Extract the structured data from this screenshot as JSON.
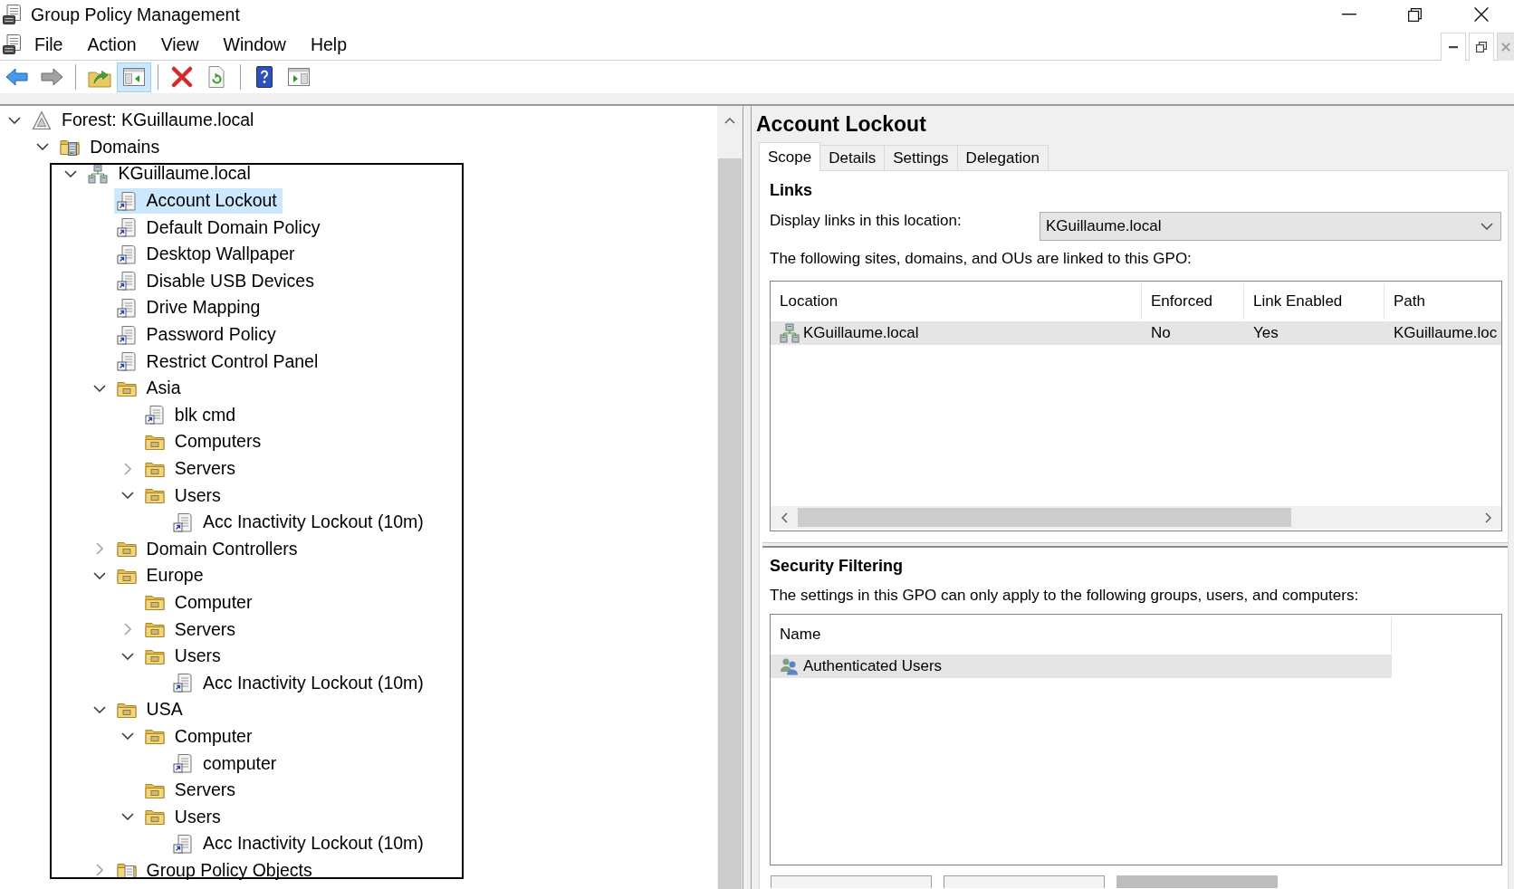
{
  "window": {
    "title": "Group Policy Management"
  },
  "menu_bar": [
    "File",
    "Action",
    "View",
    "Window",
    "Help"
  ],
  "toolbar": [
    {
      "kind": "back",
      "disabled": false,
      "pressed": false
    },
    {
      "kind": "forward",
      "disabled": true,
      "pressed": false
    },
    {
      "kind": "separator"
    },
    {
      "kind": "up",
      "disabled": false,
      "pressed": false
    },
    {
      "kind": "console-tree",
      "disabled": false,
      "pressed": true
    },
    {
      "kind": "separator"
    },
    {
      "kind": "delete",
      "disabled": false,
      "pressed": false
    },
    {
      "kind": "refresh",
      "disabled": false,
      "pressed": false
    },
    {
      "kind": "separator"
    },
    {
      "kind": "help",
      "disabled": false,
      "pressed": false
    },
    {
      "kind": "action-pane",
      "disabled": false,
      "pressed": false
    }
  ],
  "tree": {
    "items": [
      {
        "label": "Forest: KGuillaume.local",
        "kind": "forest",
        "expanded": true,
        "selected": false,
        "children": [
          {
            "label": "Domains",
            "kind": "domains",
            "expanded": true,
            "selected": false,
            "children": [
              {
                "label": "KGuillaume.local",
                "kind": "domain",
                "expanded": true,
                "selected": false,
                "children": [
                  {
                    "label": "Account Lockout",
                    "kind": "gpo-link",
                    "selected": true
                  },
                  {
                    "label": "Default Domain Policy",
                    "kind": "gpo-link",
                    "selected": false
                  },
                  {
                    "label": "Desktop Wallpaper",
                    "kind": "gpo-link",
                    "selected": false
                  },
                  {
                    "label": "Disable USB Devices",
                    "kind": "gpo-link",
                    "selected": false
                  },
                  {
                    "label": "Drive Mapping",
                    "kind": "gpo-link",
                    "selected": false
                  },
                  {
                    "label": "Password Policy",
                    "kind": "gpo-link",
                    "selected": false
                  },
                  {
                    "label": "Restrict Control Panel",
                    "kind": "gpo-link",
                    "selected": false
                  },
                  {
                    "label": "Asia",
                    "kind": "ou",
                    "expanded": true,
                    "selected": false,
                    "children": [
                      {
                        "label": "blk cmd",
                        "kind": "gpo-link",
                        "selected": false
                      },
                      {
                        "label": "Computers",
                        "kind": "ou",
                        "selected": false
                      },
                      {
                        "label": "Servers",
                        "kind": "ou",
                        "expanded": false,
                        "selected": false
                      },
                      {
                        "label": "Users",
                        "kind": "ou",
                        "expanded": true,
                        "selected": false,
                        "children": [
                          {
                            "label": "Acc Inactivity Lockout (10m)",
                            "kind": "gpo-link",
                            "selected": false
                          }
                        ]
                      }
                    ]
                  },
                  {
                    "label": "Domain Controllers",
                    "kind": "ou",
                    "expanded": false,
                    "selected": false
                  },
                  {
                    "label": "Europe",
                    "kind": "ou",
                    "expanded": true,
                    "selected": false,
                    "children": [
                      {
                        "label": "Computer",
                        "kind": "ou",
                        "selected": false
                      },
                      {
                        "label": "Servers",
                        "kind": "ou",
                        "expanded": false,
                        "selected": false
                      },
                      {
                        "label": "Users",
                        "kind": "ou",
                        "expanded": true,
                        "selected": false,
                        "children": [
                          {
                            "label": "Acc Inactivity Lockout (10m)",
                            "kind": "gpo-link",
                            "selected": false
                          }
                        ]
                      }
                    ]
                  },
                  {
                    "label": "USA",
                    "kind": "ou",
                    "expanded": true,
                    "selected": false,
                    "children": [
                      {
                        "label": "Computer",
                        "kind": "ou",
                        "expanded": true,
                        "selected": false,
                        "children": [
                          {
                            "label": "computer",
                            "kind": "gpo-link",
                            "selected": false
                          }
                        ]
                      },
                      {
                        "label": "Servers",
                        "kind": "ou",
                        "selected": false
                      },
                      {
                        "label": "Users",
                        "kind": "ou",
                        "expanded": true,
                        "selected": false,
                        "children": [
                          {
                            "label": "Acc Inactivity Lockout (10m)",
                            "kind": "gpo-link",
                            "selected": false
                          }
                        ]
                      }
                    ]
                  },
                  {
                    "label": "Group Policy Objects",
                    "kind": "gpo-container",
                    "expanded": false,
                    "selected": false
                  }
                ]
              }
            ]
          }
        ]
      }
    ]
  },
  "details": {
    "title": "Account Lockout",
    "tabs": [
      {
        "label": "Scope",
        "selected": true
      },
      {
        "label": "Details",
        "selected": false
      },
      {
        "label": "Settings",
        "selected": false
      },
      {
        "label": "Delegation",
        "selected": false
      }
    ],
    "links": {
      "heading": "Links",
      "location_label": "Display links in this location:",
      "location_value": "KGuillaume.local",
      "description": "The following sites, domains, and OUs are linked to this GPO:",
      "columns": [
        "Location",
        "Enforced",
        "Link Enabled",
        "Path"
      ],
      "rows": [
        {
          "cells": [
            "KGuillaume.local",
            "No",
            "Yes",
            "KGuillaume.loc"
          ],
          "selected": true
        }
      ]
    },
    "security_filtering": {
      "heading": "Security Filtering",
      "description": "The settings in this GPO can only apply to the following groups, users, and computers:",
      "columns": [
        "Name"
      ],
      "rows": [
        {
          "cells": [
            "Authenticated Users"
          ],
          "selected": true
        }
      ],
      "buttons": [
        {
          "disabled": false
        },
        {
          "disabled": false
        },
        {
          "disabled": true
        }
      ]
    }
  }
}
